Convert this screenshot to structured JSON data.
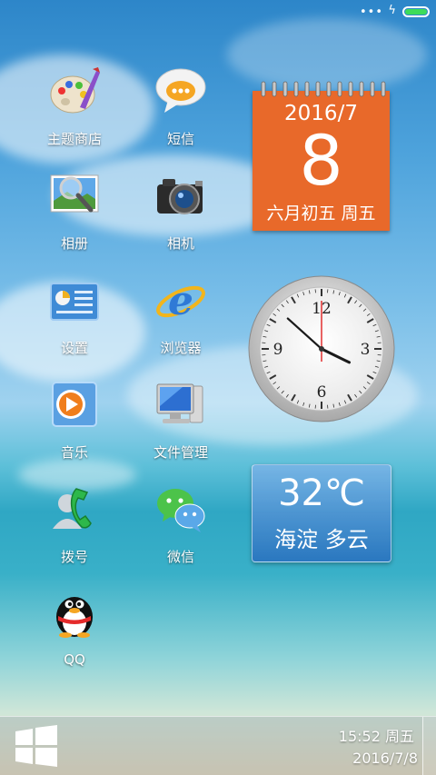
{
  "status_bar": {
    "dots": "•••",
    "charging_symbol": "ϟ",
    "battery_color": "#3ddc5a"
  },
  "apps": [
    {
      "label": "主题商店",
      "icon": "palette-icon"
    },
    {
      "label": "短信",
      "icon": "message-bubble-icon"
    },
    {
      "label": "相册",
      "icon": "photo-magnifier-icon"
    },
    {
      "label": "相机",
      "icon": "camera-icon"
    },
    {
      "label": "设置",
      "icon": "settings-panel-icon"
    },
    {
      "label": "浏览器",
      "icon": "internet-explorer-icon"
    },
    {
      "label": "音乐",
      "icon": "music-play-icon"
    },
    {
      "label": "文件管理",
      "icon": "computer-monitor-icon"
    },
    {
      "label": "拨号",
      "icon": "phone-icon"
    },
    {
      "label": "微信",
      "icon": "wechat-icon"
    },
    {
      "label": "QQ",
      "icon": "qq-penguin-icon"
    }
  ],
  "calendar": {
    "year_month": "2016/7",
    "day": "8",
    "lunar_weekday": "六月初五  周五",
    "color": "#e8692a"
  },
  "clock": {
    "numerals": [
      "12",
      "3",
      "6",
      "9"
    ],
    "time_shown": "15:52"
  },
  "weather": {
    "temperature": "32℃",
    "location_condition": "海淀  多云"
  },
  "taskbar": {
    "time": "15:52 周五",
    "date": "2016/7/8",
    "start_icon": "windows-logo-icon"
  }
}
